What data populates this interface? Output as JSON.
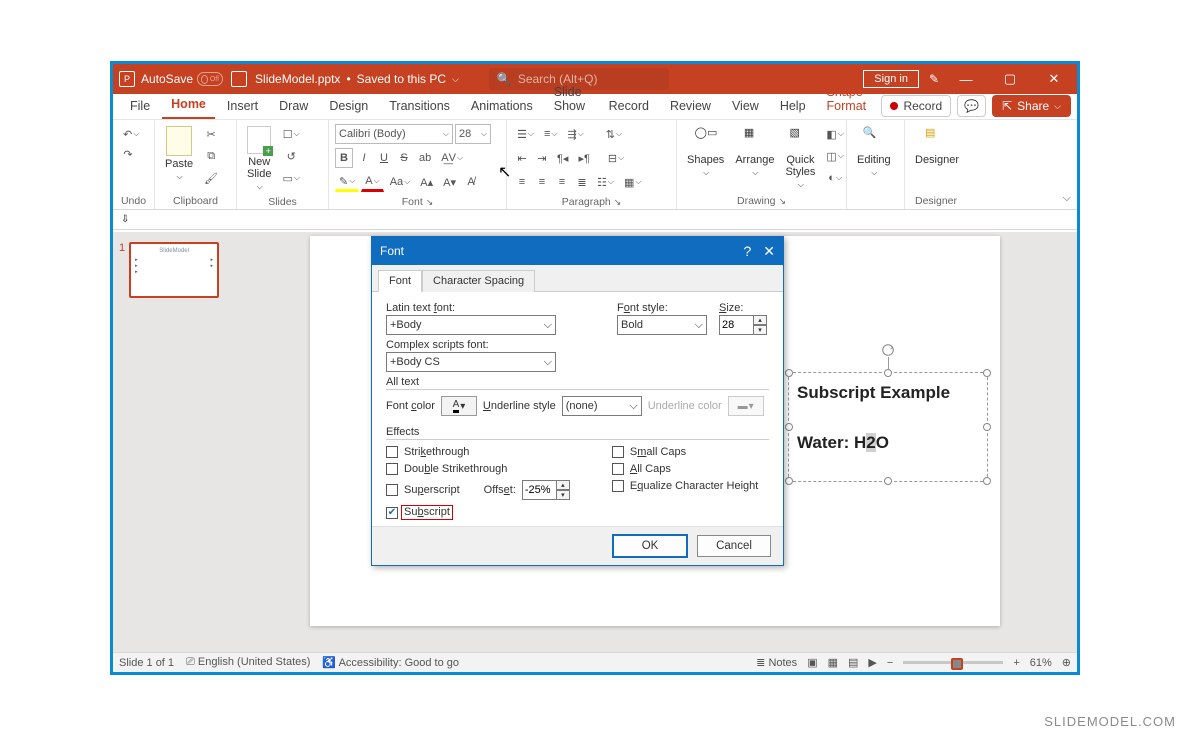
{
  "titlebar": {
    "autosave": "AutoSave",
    "autosave_state": "Off",
    "filename": "SlideModel.pptx",
    "save_status": "Saved to this PC",
    "search_placeholder": "Search (Alt+Q)",
    "signin": "Sign in"
  },
  "menubar": {
    "tabs": [
      "File",
      "Home",
      "Insert",
      "Draw",
      "Design",
      "Transitions",
      "Animations",
      "Slide Show",
      "Record",
      "Review",
      "View",
      "Help"
    ],
    "context_tab": "Shape Format",
    "record": "Record",
    "share": "Share"
  },
  "ribbon": {
    "undo": "Undo",
    "clipboard": "Clipboard",
    "paste": "Paste",
    "slides": "Slides",
    "new_slide": "New\nSlide",
    "font_group": "Font",
    "font_name": "Calibri (Body)",
    "font_size": "28",
    "paragraph": "Paragraph",
    "drawing": "Drawing",
    "shapes": "Shapes",
    "arrange": "Arrange",
    "quick_styles": "Quick\nStyles",
    "editing": "Editing",
    "designer": "Designer"
  },
  "thumb": {
    "number": "1",
    "title": "SlideModel"
  },
  "slide": {
    "title_fragment": "odel",
    "tb_heading": "Subscript Example",
    "tb_line_prefix": "Water: H",
    "tb_line_highlight": "2",
    "tb_line_suffix": "O"
  },
  "dialog": {
    "title": "Font",
    "tab_font": "Font",
    "tab_spacing": "Character Spacing",
    "latin_label": "Latin text font:",
    "latin_value": "+Body",
    "style_label": "Font style:",
    "style_value": "Bold",
    "size_label": "Size:",
    "size_value": "28",
    "complex_label": "Complex scripts font:",
    "complex_value": "+Body CS",
    "all_text": "All text",
    "font_color": "Font color",
    "underline_style": "Underline style",
    "underline_value": "(none)",
    "underline_color": "Underline color",
    "effects": "Effects",
    "strike": "Strikethrough",
    "dstrike": "Double Strikethrough",
    "superscript": "Superscript",
    "subscript": "Subscript",
    "offset": "Offset:",
    "offset_value": "-25%",
    "smallcaps": "Small Caps",
    "allcaps": "All Caps",
    "eqheight": "Equalize Character Height",
    "ok": "OK",
    "cancel": "Cancel"
  },
  "statusbar": {
    "slide": "Slide 1 of 1",
    "lang": "English (United States)",
    "access": "Accessibility: Good to go",
    "notes": "Notes",
    "zoom": "61%"
  },
  "watermark": "SLIDEMODEL.COM"
}
